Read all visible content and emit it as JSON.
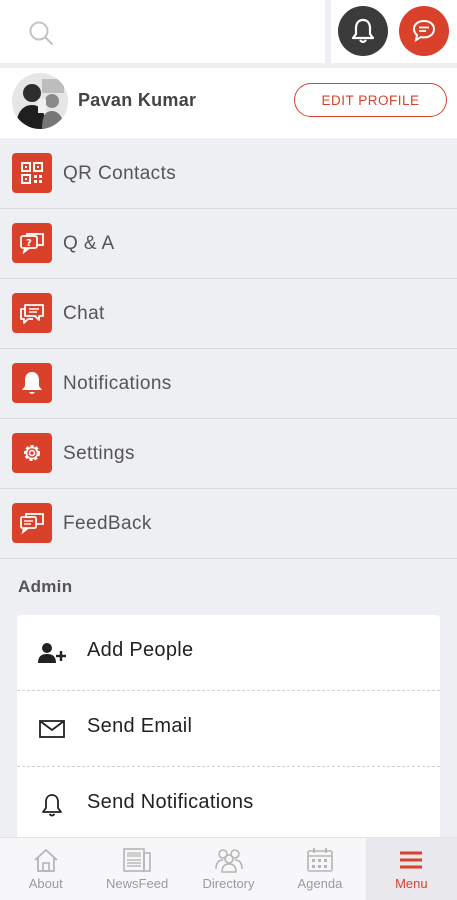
{
  "profile": {
    "name": "Pavan Kumar",
    "edit_label": "EDIT PROFILE"
  },
  "menu": {
    "items": [
      {
        "label": "QR Contacts",
        "icon": "qr-code-icon"
      },
      {
        "label": "Q & A",
        "icon": "question-chat-icon"
      },
      {
        "label": "Chat",
        "icon": "chat-bubbles-icon"
      },
      {
        "label": "Notifications",
        "icon": "bell-icon"
      },
      {
        "label": "Settings",
        "icon": "gear-icon"
      },
      {
        "label": "FeedBack",
        "icon": "feedback-icon"
      }
    ]
  },
  "admin": {
    "title": "Admin",
    "items": [
      {
        "label": "Add People",
        "icon": "add-person-icon"
      },
      {
        "label": "Send Email",
        "icon": "envelope-icon"
      },
      {
        "label": "Send Notifications",
        "icon": "bell-outline-icon"
      }
    ]
  },
  "bottom_nav": {
    "items": [
      {
        "label": "About",
        "icon": "home-icon"
      },
      {
        "label": "NewsFeed",
        "icon": "newspaper-icon"
      },
      {
        "label": "Directory",
        "icon": "people-icon"
      },
      {
        "label": "Agenda",
        "icon": "calendar-icon"
      },
      {
        "label": "Menu",
        "icon": "hamburger-icon"
      }
    ],
    "active_index": 4
  },
  "colors": {
    "accent": "#d9412b",
    "dark": "#3b3b3b",
    "background": "#eeeff3"
  }
}
